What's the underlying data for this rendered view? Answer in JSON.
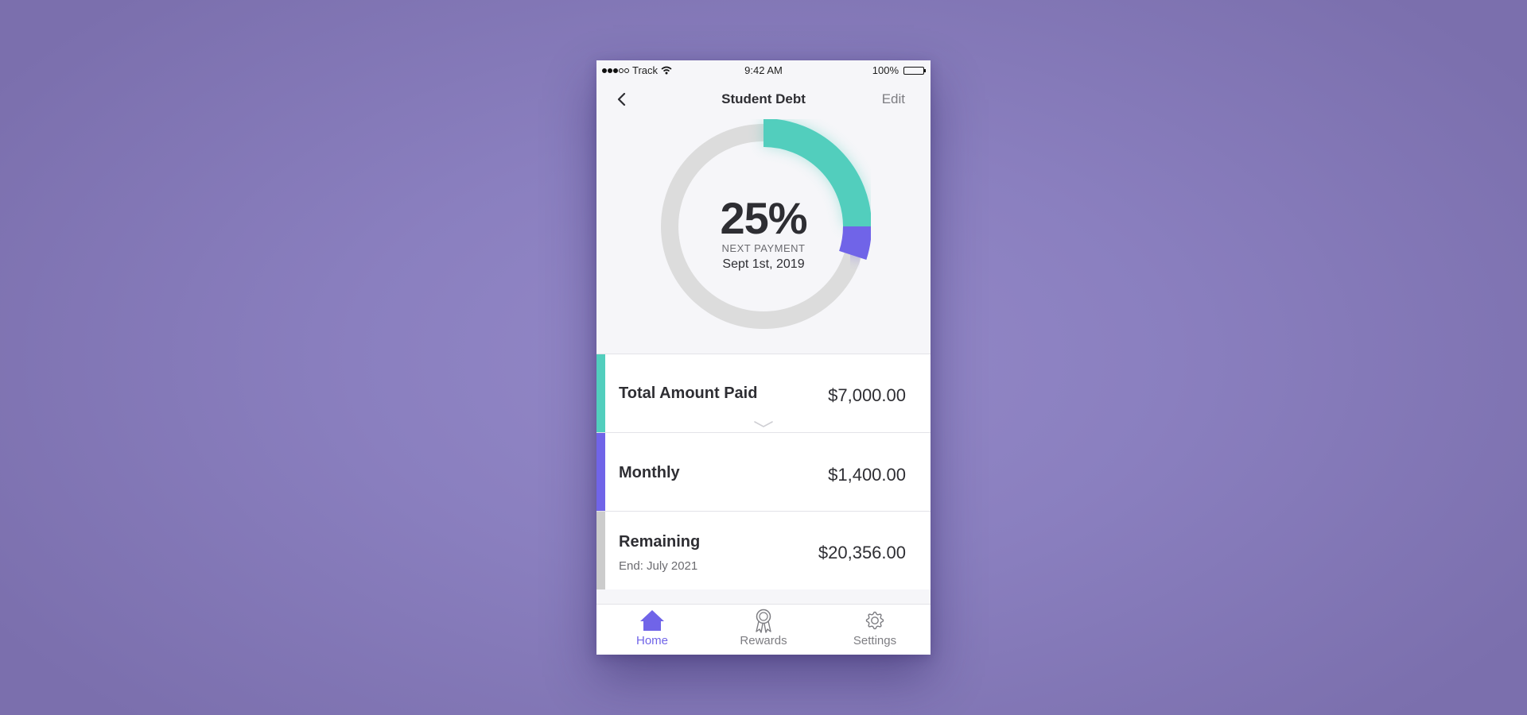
{
  "status_bar": {
    "carrier": "Track",
    "time": "9:42 AM",
    "battery": "100%"
  },
  "nav": {
    "title": "Student Debt",
    "edit_label": "Edit",
    "back_icon": "chevron-left-icon"
  },
  "progress": {
    "percent_text": "25%",
    "paid_fraction": 0.25,
    "next_payment_fraction": 0.05,
    "label": "NEXT PAYMENT",
    "date": "Sept 1st, 2019"
  },
  "rows": [
    {
      "title": "Total Amount Paid",
      "subtitle": "",
      "amount": "$7,000.00",
      "color": "#52cebd"
    },
    {
      "title": "Monthly",
      "subtitle": "",
      "amount": "$1,400.00",
      "color": "#7064e8"
    },
    {
      "title": "Remaining",
      "subtitle": "End: July 2021",
      "amount": "$20,356.00",
      "color": "#cccccc"
    }
  ],
  "tabs": [
    {
      "label": "Home",
      "icon": "home-icon",
      "active": true
    },
    {
      "label": "Rewards",
      "icon": "award-icon",
      "active": false
    },
    {
      "label": "Settings",
      "icon": "gear-icon",
      "active": false
    }
  ],
  "colors": {
    "accent": "#7064e8",
    "paid": "#52cebd",
    "track": "#dcdcdc",
    "background": "#f6f6f9"
  }
}
